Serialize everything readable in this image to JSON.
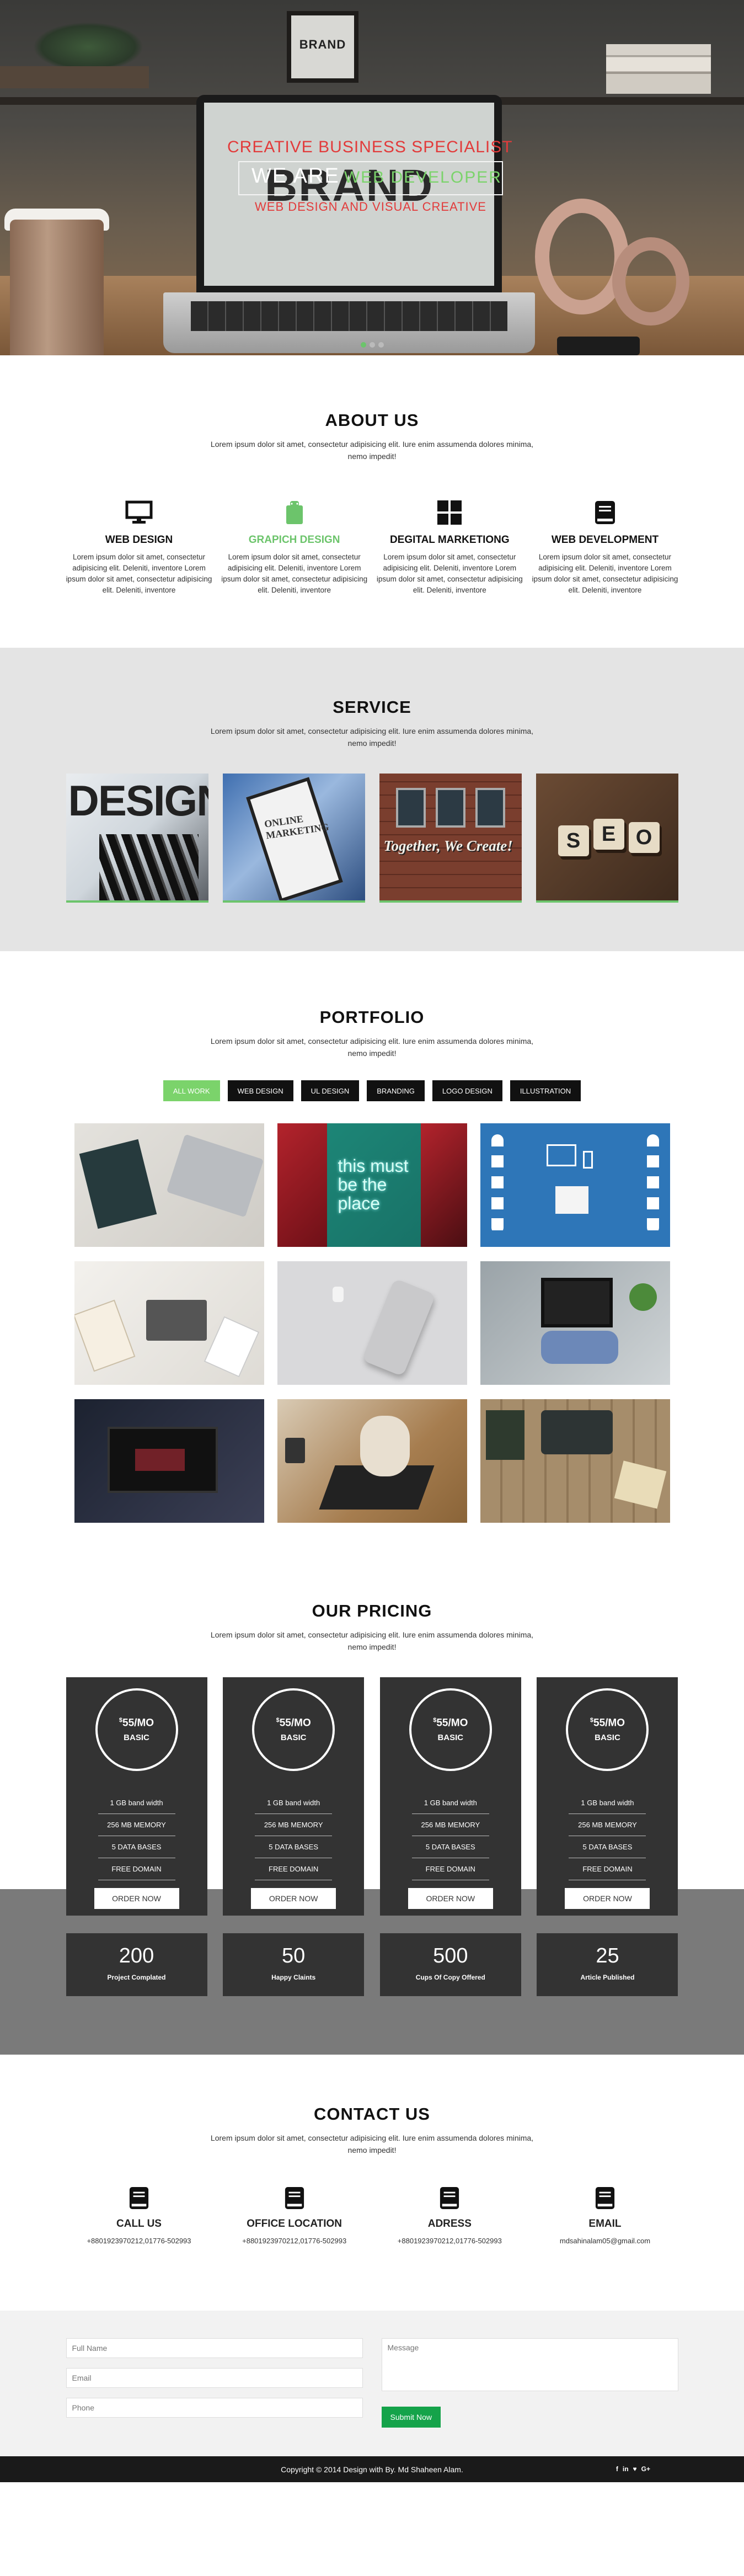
{
  "hero": {
    "frame_text": "BRAND",
    "headline": "CREATIVE BUSINESS SPECIALIST",
    "we_are": "WE ARE",
    "we_are_green": "WEB DEVELOPER",
    "tagline": "WEB DESIGN AND VISUAL CREATIVE",
    "screen_word": "BRAND",
    "slide_count": 3,
    "active_slide": 1
  },
  "about": {
    "title": "ABOUT US",
    "subtitle": "Lorem ipsum dolor sit amet, consectetur adipisicing elit. Iure enim assumenda dolores minima, nemo impedit!",
    "features": [
      {
        "icon": "monitor-icon",
        "title": "WEB DESIGN",
        "text": "Lorem ipsum dolor sit amet, consectetur adipisicing elit. Deleniti, inventore Lorem ipsum dolor sit amet, consectetur adipisicing elit. Deleniti, inventore"
      },
      {
        "icon": "android-icon",
        "title": "GRAPICH DESIGN",
        "text": "Lorem ipsum dolor sit amet, consectetur adipisicing elit. Deleniti, inventore Lorem ipsum dolor sit amet, consectetur adipisicing elit. Deleniti, inventore"
      },
      {
        "icon": "windows-icon",
        "title": "DEGITAL MARKETIONG",
        "text": "Lorem ipsum dolor sit amet, consectetur adipisicing elit. Deleniti, inventore Lorem ipsum dolor sit amet, consectetur adipisicing elit. Deleniti, inventore"
      },
      {
        "icon": "book-icon",
        "title": "WEB DEVELOPMENT",
        "text": "Lorem ipsum dolor sit amet, consectetur adipisicing elit. Deleniti, inventore Lorem ipsum dolor sit amet, consectetur adipisicing elit. Deleniti, inventore"
      }
    ]
  },
  "service": {
    "title": "SERVICE",
    "subtitle": "Lorem ipsum dolor sit amet, consectetur adipisicing elit. Iure enim assumenda dolores minima, nemo impedit!",
    "images": [
      {
        "label": "DESIGN"
      },
      {
        "label": "ONLINE MARKETING"
      },
      {
        "label": "Together, We Create!"
      },
      {
        "label": "SEO"
      }
    ]
  },
  "portfolio": {
    "title": "PORTFOLIO",
    "subtitle": "Lorem ipsum dolor sit amet, consectetur adipisicing elit. Iure enim assumenda dolores minima, nemo impedit!",
    "filters": [
      "ALL WORK",
      "WEB DESIGN",
      "UL DESIGN",
      "BRANDING",
      "LOGO DESIGN",
      "ILLUSTRATION"
    ],
    "active_filter": "ALL WORK",
    "neon_text": "this must be the place"
  },
  "pricing": {
    "title": "OUR PRICING",
    "subtitle": "Lorem ipsum dolor sit amet, consectetur adipisicing elit. Iure enim assumenda dolores minima, nemo impedit!",
    "plans": [
      {
        "currency": "$",
        "price": "55/MO",
        "tier": "BASIC",
        "features": [
          "1 GB band width",
          "256 MB MEMORY",
          "5 DATA BASES",
          "FREE DOMAIN"
        ],
        "button": "ORDER NOW"
      },
      {
        "currency": "$",
        "price": "55/MO",
        "tier": "BASIC",
        "features": [
          "1 GB band width",
          "256 MB MEMORY",
          "5 DATA BASES",
          "FREE DOMAIN"
        ],
        "button": "ORDER NOW"
      },
      {
        "currency": "$",
        "price": "55/MO",
        "tier": "BASIC",
        "features": [
          "1 GB band width",
          "256 MB MEMORY",
          "5 DATA BASES",
          "FREE DOMAIN"
        ],
        "button": "ORDER NOW"
      },
      {
        "currency": "$",
        "price": "55/MO",
        "tier": "BASIC",
        "features": [
          "1 GB band width",
          "256 MB MEMORY",
          "5 DATA BASES",
          "FREE DOMAIN"
        ],
        "button": "ORDER NOW"
      }
    ]
  },
  "counters": [
    {
      "number": "200",
      "label": "Project Complated"
    },
    {
      "number": "50",
      "label": "Happy Claints"
    },
    {
      "number": "500",
      "label": "Cups Of Copy Offered"
    },
    {
      "number": "25",
      "label": "Article Published"
    }
  ],
  "contact": {
    "title": "CONTACT US",
    "subtitle": "Lorem ipsum dolor sit amet, consectetur adipisicing elit. Iure enim assumenda dolores minima, nemo impedit!",
    "items": [
      {
        "icon": "book-icon",
        "title": "CALL US",
        "value": "+8801923970212,01776-502993"
      },
      {
        "icon": "book-icon",
        "title": "OFFICE LOCATION",
        "value": "+8801923970212,01776-502993"
      },
      {
        "icon": "book-icon",
        "title": "ADRESS",
        "value": "+8801923970212,01776-502993"
      },
      {
        "icon": "book-icon",
        "title": "EMAIL",
        "value": "mdsahinalam05@gmail.com"
      }
    ]
  },
  "form": {
    "full_name_placeholder": "Full Name",
    "email_placeholder": "Email",
    "phone_placeholder": "Phone",
    "message_placeholder": "Message",
    "submit_label": "Submit Now"
  },
  "footer": {
    "copyright": "Copyright © 2014 Design with By. Md Shaheen Alam.",
    "social": [
      "f",
      "in",
      "♥",
      "G+"
    ]
  },
  "colors": {
    "accent": "#6cc46b",
    "dark": "#333333",
    "hero_red": "#e23b3b",
    "submit": "#15a34a"
  }
}
